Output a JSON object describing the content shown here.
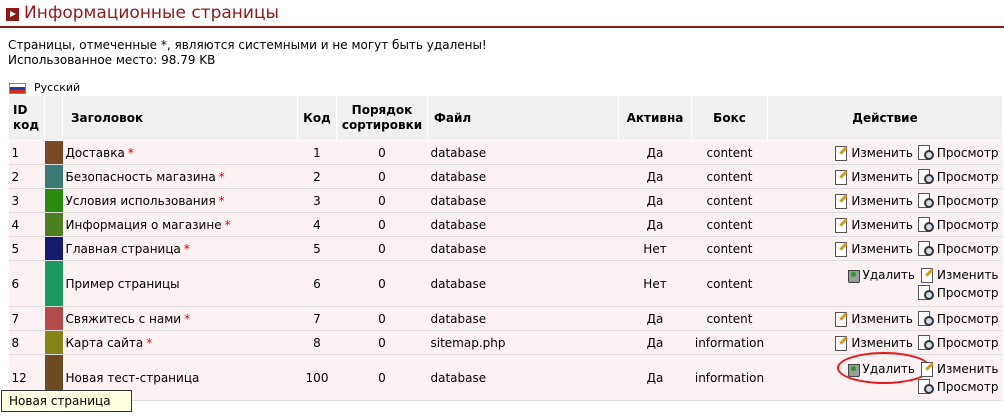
{
  "header": {
    "title": "Информационные страницы"
  },
  "notice": {
    "system_note": "Страницы, отмеченные *, являются системными и не могут быть удалены!",
    "used_space": "Использованное место: 98.79 KB"
  },
  "language": {
    "label": "Русский",
    "flag_colors": [
      "#ffffff",
      "#1c3fa8",
      "#d52b1e"
    ]
  },
  "table": {
    "columns": {
      "id_line1": "ID",
      "id_line2": "код",
      "title": "Заголовок",
      "code": "Код",
      "sort_line1": "Порядок",
      "sort_line2": "сортировки",
      "file": "Файл",
      "active": "Активна",
      "box": "Бокс",
      "action": "Действие"
    },
    "system_marker": "*",
    "actions": {
      "edit": "Изменить",
      "view": "Просмотр",
      "delete": "Удалить"
    },
    "rows": [
      {
        "id": "1",
        "color": "#7a4a28",
        "title": "Доставка",
        "system": true,
        "code": "1",
        "sort": "0",
        "file": "database",
        "active": "Да",
        "box": "content"
      },
      {
        "id": "2",
        "color": "#3a7a74",
        "title": "Безопасность магазина",
        "system": true,
        "code": "2",
        "sort": "0",
        "file": "database",
        "active": "Да",
        "box": "content"
      },
      {
        "id": "3",
        "color": "#2a8a12",
        "title": "Условия использования",
        "system": true,
        "code": "3",
        "sort": "0",
        "file": "database",
        "active": "Да",
        "box": "content"
      },
      {
        "id": "4",
        "color": "#4c7e22",
        "title": "Информация о магазине",
        "system": true,
        "code": "4",
        "sort": "0",
        "file": "database",
        "active": "Да",
        "box": "content"
      },
      {
        "id": "5",
        "color": "#141a6e",
        "title": "Главная страница",
        "system": true,
        "code": "5",
        "sort": "0",
        "file": "database",
        "active": "Нет",
        "box": "content"
      },
      {
        "id": "6",
        "color": "#1a9a62",
        "title": "Пример страницы",
        "system": false,
        "code": "6",
        "sort": "0",
        "file": "database",
        "active": "Нет",
        "box": "content"
      },
      {
        "id": "7",
        "color": "#b24c4c",
        "title": "Свяжитесь с нами",
        "system": true,
        "code": "7",
        "sort": "0",
        "file": "database",
        "active": "Да",
        "box": "content"
      },
      {
        "id": "8",
        "color": "#86831a",
        "title": "Карта сайта",
        "system": true,
        "code": "8",
        "sort": "0",
        "file": "sitemap.php",
        "active": "Да",
        "box": "information"
      },
      {
        "id": "12",
        "color": "#6e4a22",
        "title": "Новая тест-страница",
        "system": false,
        "code": "100",
        "sort": "0",
        "file": "database",
        "active": "Да",
        "box": "information"
      }
    ]
  },
  "footer": {
    "new_page_label": "Новая страница"
  },
  "colors": {
    "accent": "#8b1a1a",
    "header_bg": "#f0f0f0",
    "row_bg": "#fdf2f3",
    "highlight_ring": "#e41b1b"
  }
}
